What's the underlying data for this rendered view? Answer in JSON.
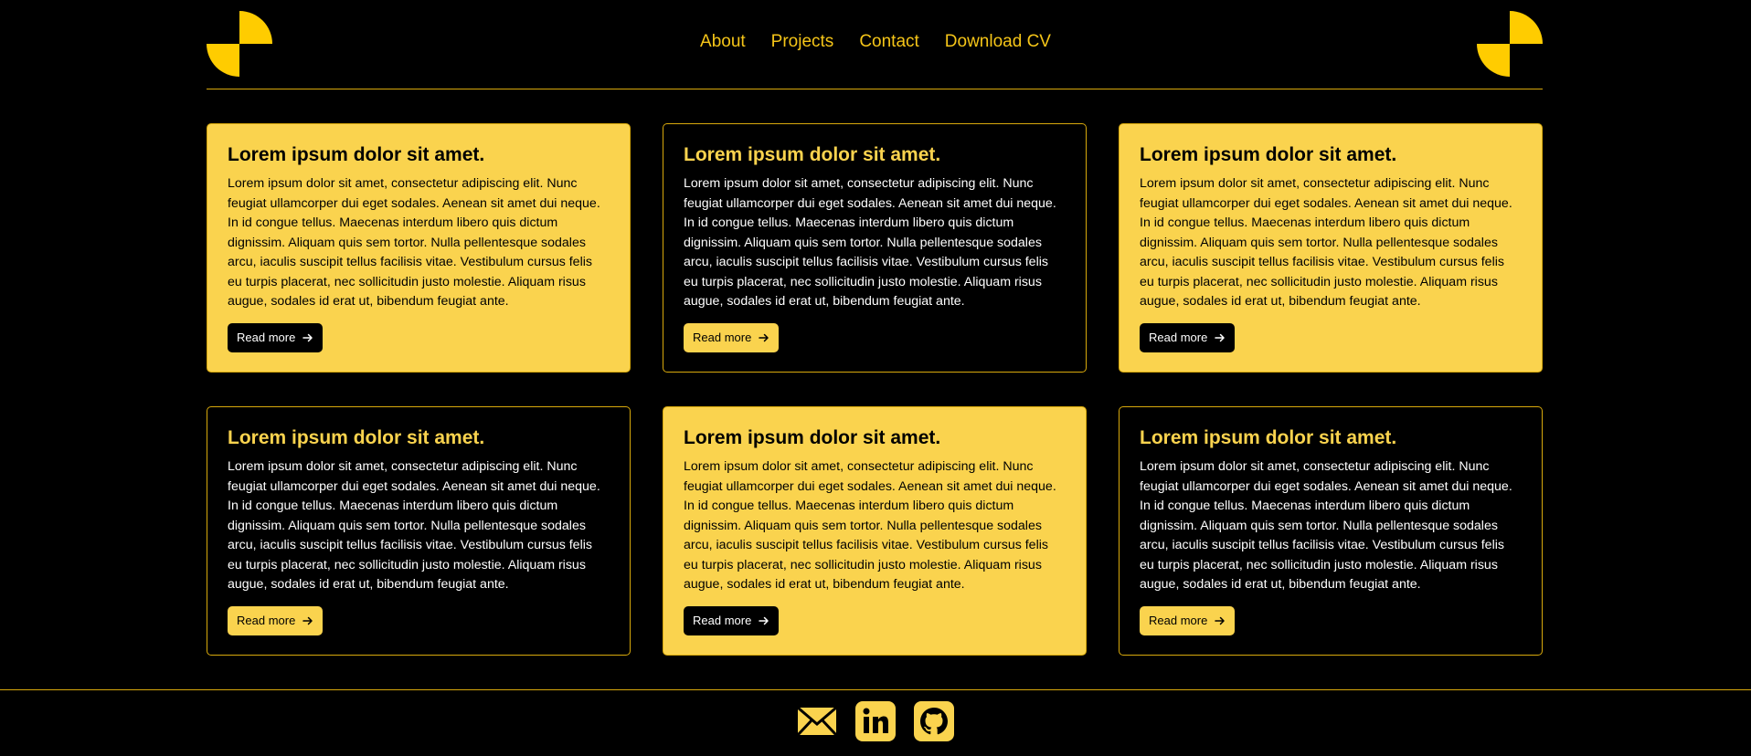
{
  "brand": {
    "accent": "#FAD34E",
    "logo_color": "#FFCC00",
    "rule_color": "#D8A90C"
  },
  "nav": {
    "items": [
      {
        "label": "About"
      },
      {
        "label": "Projects"
      },
      {
        "label": "Contact"
      },
      {
        "label": "Download CV"
      }
    ]
  },
  "cards": [
    {
      "variant": "light",
      "title": "Lorem ipsum dolor sit amet.",
      "body": "Lorem ipsum dolor sit amet, consectetur adipiscing elit. Nunc feugiat ullamcorper dui eget sodales. Aenean sit amet dui neque. In id congue tellus. Maecenas interdum libero quis dictum dignissim. Aliquam quis sem tortor. Nulla pellentesque sodales arcu, iaculis suscipit tellus facilisis vitae. Vestibulum cursus felis eu turpis placerat, nec sollicitudin justo molestie. Aliquam risus augue, sodales id erat ut, bibendum feugiat ante.",
      "button_label": "Read more",
      "button_icon": "arrow-right-icon"
    },
    {
      "variant": "dark",
      "title": "Lorem ipsum dolor sit amet.",
      "body": "Lorem ipsum dolor sit amet, consectetur adipiscing elit. Nunc feugiat ullamcorper dui eget sodales. Aenean sit amet dui neque. In id congue tellus. Maecenas interdum libero quis dictum dignissim. Aliquam quis sem tortor. Nulla pellentesque sodales arcu, iaculis suscipit tellus facilisis vitae. Vestibulum cursus felis eu turpis placerat, nec sollicitudin justo molestie. Aliquam risus augue, sodales id erat ut, bibendum feugiat ante.",
      "button_label": "Read more",
      "button_icon": "arrow-right-icon"
    },
    {
      "variant": "light",
      "title": "Lorem ipsum dolor sit amet.",
      "body": "Lorem ipsum dolor sit amet, consectetur adipiscing elit. Nunc feugiat ullamcorper dui eget sodales. Aenean sit amet dui neque. In id congue tellus. Maecenas interdum libero quis dictum dignissim. Aliquam quis sem tortor. Nulla pellentesque sodales arcu, iaculis suscipit tellus facilisis vitae. Vestibulum cursus felis eu turpis placerat, nec sollicitudin justo molestie. Aliquam risus augue, sodales id erat ut, bibendum feugiat ante.",
      "button_label": "Read more",
      "button_icon": "arrow-right-icon"
    },
    {
      "variant": "dark",
      "title": "Lorem ipsum dolor sit amet.",
      "body": "Lorem ipsum dolor sit amet, consectetur adipiscing elit. Nunc feugiat ullamcorper dui eget sodales. Aenean sit amet dui neque. In id congue tellus. Maecenas interdum libero quis dictum dignissim. Aliquam quis sem tortor. Nulla pellentesque sodales arcu, iaculis suscipit tellus facilisis vitae. Vestibulum cursus felis eu turpis placerat, nec sollicitudin justo molestie. Aliquam risus augue, sodales id erat ut, bibendum feugiat ante.",
      "button_label": "Read more",
      "button_icon": "arrow-right-icon"
    },
    {
      "variant": "light",
      "title": "Lorem ipsum dolor sit amet.",
      "body": "Lorem ipsum dolor sit amet, consectetur adipiscing elit. Nunc feugiat ullamcorper dui eget sodales. Aenean sit amet dui neque. In id congue tellus. Maecenas interdum libero quis dictum dignissim. Aliquam quis sem tortor. Nulla pellentesque sodales arcu, iaculis suscipit tellus facilisis vitae. Vestibulum cursus felis eu turpis placerat, nec sollicitudin justo molestie. Aliquam risus augue, sodales id erat ut, bibendum feugiat ante.",
      "button_label": "Read more",
      "button_icon": "arrow-right-icon"
    },
    {
      "variant": "dark",
      "title": "Lorem ipsum dolor sit amet.",
      "body": "Lorem ipsum dolor sit amet, consectetur adipiscing elit. Nunc feugiat ullamcorper dui eget sodales. Aenean sit amet dui neque. In id congue tellus. Maecenas interdum libero quis dictum dignissim. Aliquam quis sem tortor. Nulla pellentesque sodales arcu, iaculis suscipit tellus facilisis vitae. Vestibulum cursus felis eu turpis placerat, nec sollicitudin justo molestie. Aliquam risus augue, sodales id erat ut, bibendum feugiat ante.",
      "button_label": "Read more",
      "button_icon": "arrow-right-icon"
    }
  ],
  "footer": {
    "social": [
      {
        "icon": "email-icon"
      },
      {
        "icon": "linkedin-icon"
      },
      {
        "icon": "github-icon"
      }
    ]
  }
}
